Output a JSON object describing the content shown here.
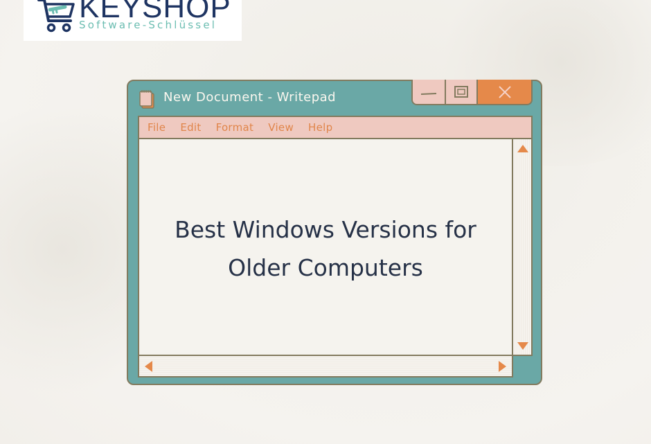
{
  "logo": {
    "brand": "KEYSHOP",
    "tagline": "Software-Schlüssel",
    "icon": "shopping-cart-key-icon"
  },
  "window": {
    "title": "New Document - Writepad",
    "app_icon": "notepad-icon",
    "controls": {
      "minimize_icon": "minimize-icon",
      "maximize_icon": "maximize-icon",
      "close_icon": "close-icon"
    },
    "menu": [
      {
        "label": "File"
      },
      {
        "label": "Edit"
      },
      {
        "label": "Format"
      },
      {
        "label": "View"
      },
      {
        "label": "Help"
      }
    ],
    "document": {
      "line1": "Best Windows Versions for",
      "line2": "Older Computers"
    },
    "scrollbars": {
      "up_icon": "arrow-up-icon",
      "down_icon": "arrow-down-icon",
      "left_icon": "arrow-left-icon",
      "right_icon": "arrow-right-icon"
    }
  },
  "colors": {
    "window_frame": "#6aa8a6",
    "menubar": "#efc9c0",
    "accent_orange": "#e5894a",
    "border": "#827a5e",
    "text_dark": "#263147",
    "logo_navy": "#1e3462",
    "logo_teal": "#6bbdb1"
  }
}
